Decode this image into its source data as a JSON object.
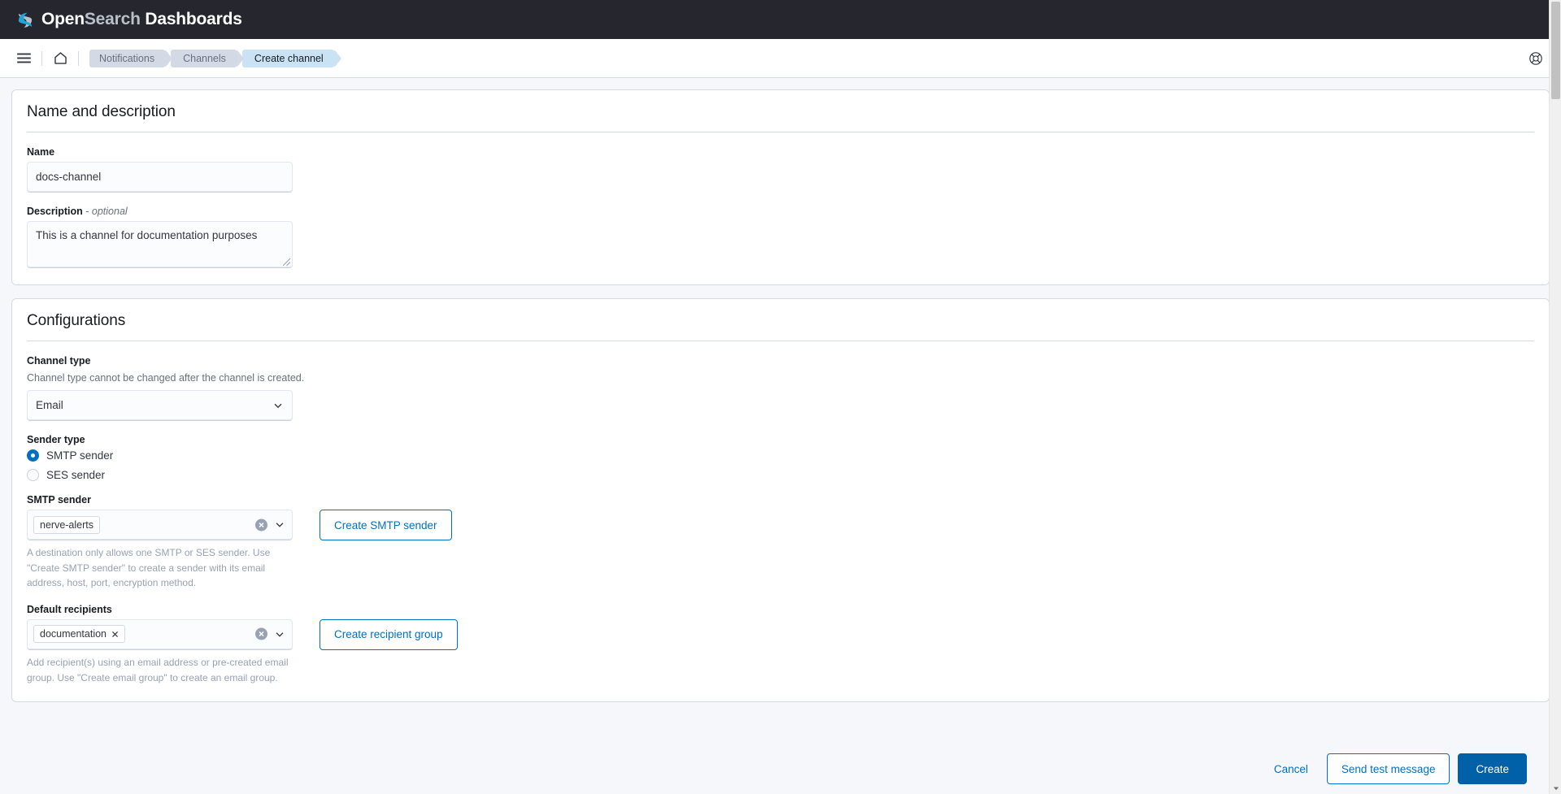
{
  "app": {
    "brand_open": "Open",
    "brand_search": "Search",
    "brand_dashboards": "Dashboards",
    "logo_icon": "opensearch-logo-icon",
    "menu_icon": "hamburger-menu-icon",
    "home_icon": "home-icon",
    "help_icon": "help-life-preserver-icon"
  },
  "breadcrumbs": [
    {
      "label": "Notifications",
      "active": false
    },
    {
      "label": "Channels",
      "active": false
    },
    {
      "label": "Create channel",
      "active": true
    }
  ],
  "name_panel": {
    "title": "Name and description",
    "name_label": "Name",
    "name_value": "docs-channel",
    "name_placeholder": "",
    "description_label": "Description",
    "description_dash": "-",
    "description_optional": "optional",
    "description_value": "This is a channel for documentation purposes",
    "description_placeholder": ""
  },
  "config_panel": {
    "title": "Configurations",
    "channel_type_label": "Channel type",
    "channel_type_help": "Channel type cannot be changed after the channel is created.",
    "channel_type_value": "Email",
    "channel_type_options": [
      "Email"
    ],
    "sender_type_label": "Sender type",
    "sender_options": [
      {
        "label": "SMTP sender",
        "checked": true
      },
      {
        "label": "SES sender",
        "checked": false
      }
    ],
    "smtp_sender_label": "SMTP sender",
    "smtp_sender_pill": "nerve-alerts",
    "smtp_sender_help": "A destination only allows one SMTP or SES sender. Use \"Create SMTP sender\" to create a sender with its email address, host, port, encryption method.",
    "create_smtp_sender_button": "Create SMTP sender",
    "recipients_label": "Default recipients",
    "recipients_pill": "documentation",
    "recipients_help": "Add recipient(s) using an email address or pre-created email group. Use \"Create email group\" to create an email group.",
    "create_recipient_group_button": "Create recipient group",
    "clear_icon": "clear-circle-icon",
    "chevron_icon": "chevron-down-icon",
    "pill_remove_icon": "close-x-icon"
  },
  "footer": {
    "cancel": "Cancel",
    "send_test": "Send test message",
    "create": "Create"
  },
  "colors": {
    "accent": "#0071c2",
    "primary_fill": "#0060a8",
    "header_bg": "#25262e",
    "crumb_bg": "#d3dae6",
    "crumb_active_bg": "#c9e3f5"
  }
}
